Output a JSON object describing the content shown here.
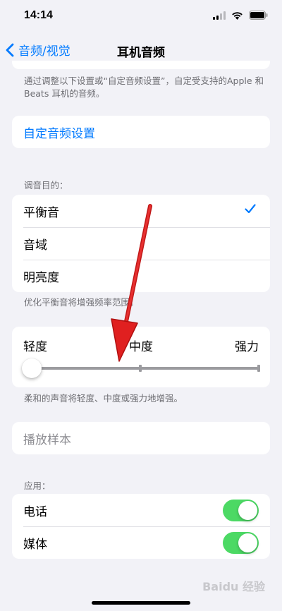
{
  "status": {
    "time": "14:14"
  },
  "nav": {
    "back_label": "音频/视觉",
    "title": "耳机音频"
  },
  "intro_note": "通过调整以下设置或“自定音频设置”，自定受支持的Apple 和 Beats 耳机的音频。",
  "custom_setup": {
    "label": "自定音频设置"
  },
  "tuning": {
    "header": "调音目的：",
    "options": [
      "平衡音",
      "音域",
      "明亮度"
    ],
    "selected_index": 0,
    "footnote": "优化平衡音将增强频率范围。"
  },
  "strength": {
    "labels": [
      "轻度",
      "中度",
      "强力"
    ],
    "level": 0,
    "footnote": "柔和的声音将轻度、中度或强力地增强。"
  },
  "sample": {
    "label": "播放样本"
  },
  "apply": {
    "header": "应用：",
    "items": [
      {
        "label": "电话",
        "on": true
      },
      {
        "label": "媒体",
        "on": true
      }
    ]
  },
  "colors": {
    "accent": "#007aff",
    "toggle_on": "#4cd964",
    "arrow": "#e02020"
  },
  "watermark": "Baidu 经验"
}
